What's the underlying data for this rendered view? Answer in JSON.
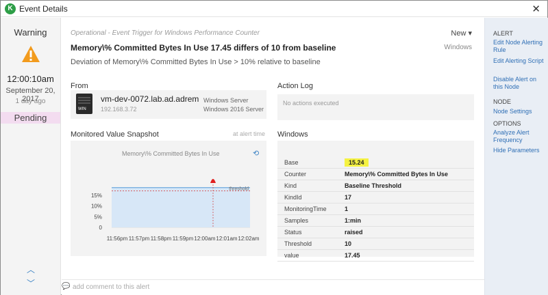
{
  "window": {
    "title": "Event Details",
    "logo_letter": "K",
    "close": "✕"
  },
  "left": {
    "severity": "Warning",
    "time": "12:00:10am",
    "date": "September 20, 2017",
    "ago": "1 day ago",
    "status": "Pending",
    "nav_up": "︿",
    "nav_down": "﹀"
  },
  "header": {
    "eyebrow": "Operational - Event Trigger for Windows Performance Counter",
    "new_label": "New ▾",
    "category": "Windows",
    "title": "Memory\\% Committed Bytes In Use 17.45 differs of 10 from baseline",
    "description": "Deviation of Memory\\% Committed Bytes In Use > 10% relative to baseline"
  },
  "from": {
    "heading": "From",
    "host": "vm-dev-0072.lab.ad.adrem",
    "ip": "192.168.3.72",
    "os_line1": "Windows Server",
    "os_line2": "Windows 2016 Server",
    "icon_tag": "WIN"
  },
  "action_log": {
    "heading": "Action Log",
    "empty": "No actions executed"
  },
  "snapshot": {
    "heading": "Monitored Value Snapshot",
    "at_time": "at alert time",
    "refresh_icon": "⟲"
  },
  "chart_data": {
    "type": "area",
    "title": "Memory\\% Committed Bytes In Use",
    "y_ticks": [
      "15%",
      "10%",
      "5%",
      "0"
    ],
    "ylim": [
      0,
      20
    ],
    "x_ticks": [
      "11:56pm",
      "11:57pm",
      "11:58pm",
      "11:59pm",
      "12:00am",
      "12:01am",
      "12:02am"
    ],
    "series": [
      {
        "values": [
          18.5,
          18.5,
          18.5,
          18.5,
          18.5,
          18.5,
          18.5
        ]
      }
    ],
    "threshold": {
      "label": "threshold",
      "value": 17
    },
    "alert_marker_x": "12:00am",
    "colors": {
      "area": "#d7e7f7",
      "line": "#6ea8de",
      "threshold": "#d34a4a",
      "marker": "#e02020"
    }
  },
  "windows": {
    "heading": "Windows",
    "rows": [
      {
        "key": "Base",
        "value": "15.24"
      },
      {
        "key": "Counter",
        "value": "Memory\\% Committed Bytes In Use"
      },
      {
        "key": "Kind",
        "value": "Baseline Threshold"
      },
      {
        "key": "KindId",
        "value": "17"
      },
      {
        "key": "MonitoringTime",
        "value": "1"
      },
      {
        "key": "Samples",
        "value": "1:min"
      },
      {
        "key": "Status",
        "value": "raised"
      },
      {
        "key": "Threshold",
        "value": "10"
      },
      {
        "key": "value",
        "value": "17.45"
      }
    ],
    "highlight_color": "#f5f242"
  },
  "comment": {
    "icon": "💬",
    "placeholder": "add comment to this alert"
  },
  "right": {
    "alert_heading": "ALERT",
    "edit_node_rule": "Edit Node Alerting Rule",
    "edit_script": "Edit Alerting Script",
    "disable_alert": "Disable Alert on this Node",
    "node_heading": "NODE",
    "node_settings": "Node Settings",
    "options_heading": "OPTIONS",
    "analyze": "Analyze Alert Frequency",
    "hide_params": "Hide Parameters"
  }
}
